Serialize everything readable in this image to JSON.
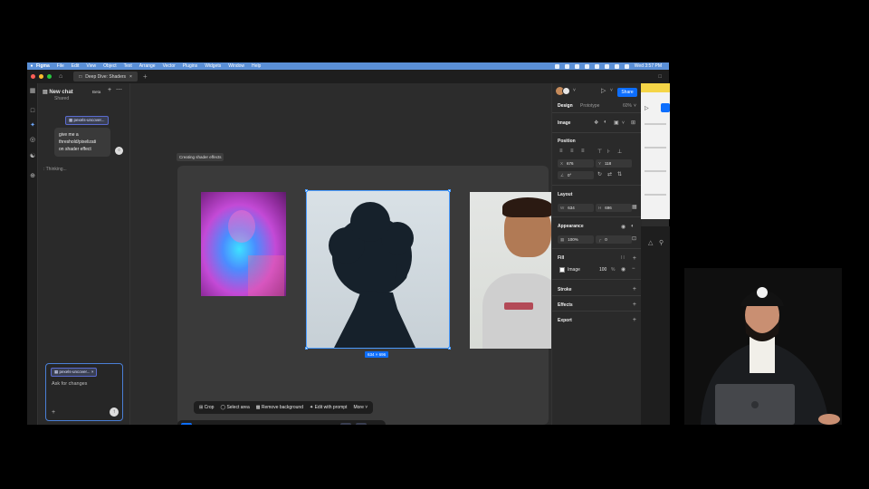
{
  "menubar": {
    "apple": "",
    "items": [
      "Figma",
      "File",
      "Edit",
      "View",
      "Object",
      "Text",
      "Arrange",
      "Vector",
      "Plugins",
      "Widgets",
      "Window",
      "Help"
    ],
    "clock": "Wed 3:57 PM"
  },
  "tabs": {
    "file_tab": "Deep Dive: Shaders"
  },
  "chat": {
    "title": "New chat",
    "subtitle": "Shared",
    "beta_label": "Beta",
    "attachment_chip": "pexels-uncover...",
    "user_message_line1": "give me a",
    "user_message_line2": "threshold/pixelizati",
    "user_message_line3": "on shader effect",
    "thinking": "Thinking...",
    "composer_chip": "pexels-uncover...",
    "composer_placeholder": "Ask for changes"
  },
  "canvas": {
    "status_tag": "Creating shader effects",
    "selection_size": "634 × 696",
    "context_toolbar": [
      "Crop",
      "Select area",
      "Remove background",
      "Edit with prompt",
      "More"
    ]
  },
  "panel": {
    "share_label": "Share",
    "tabs": [
      "Design",
      "Prototype"
    ],
    "zoom": "60%",
    "layer_type": "Image",
    "sections": {
      "position": "Position",
      "layout": "Layout",
      "appearance": "Appearance",
      "fill": "Fill",
      "stroke": "Stroke",
      "effects": "Effects",
      "export": "Export"
    },
    "x_label": "X",
    "x_value": "676",
    "y_label": "Y",
    "y_value": "118",
    "rotation": "0°",
    "w_label": "W",
    "w_value": "634",
    "h_label": "H",
    "h_value": "696",
    "opacity": "100%",
    "radius": "0",
    "fill_name": "Image",
    "fill_opacity": "100",
    "fill_unit": "%"
  },
  "colors": {
    "accent": "#0d6efd",
    "menubar": "#5a8fd6",
    "panel_bg": "#2a2a2a",
    "canvas_bg": "#2c2c2c"
  }
}
